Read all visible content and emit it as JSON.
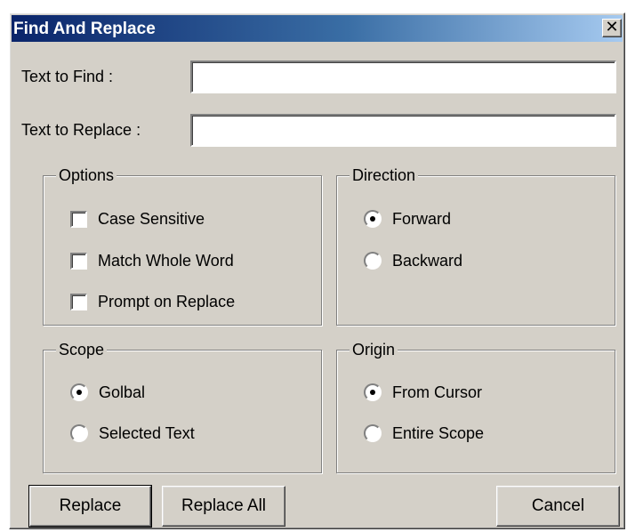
{
  "window": {
    "title": "Find And Replace",
    "close_glyph": "✕"
  },
  "find": {
    "label": "Text to Find :",
    "value": ""
  },
  "replace": {
    "label": "Text to Replace :",
    "value": ""
  },
  "options": {
    "legend": "Options",
    "items": [
      {
        "label": "Case Sensitive",
        "checked": false
      },
      {
        "label": "Match Whole Word",
        "checked": false
      },
      {
        "label": "Prompt on Replace",
        "checked": false
      }
    ]
  },
  "direction": {
    "legend": "Direction",
    "items": [
      {
        "label": "Forward",
        "selected": true
      },
      {
        "label": "Backward",
        "selected": false
      }
    ]
  },
  "scope": {
    "legend": "Scope",
    "items": [
      {
        "label": "Golbal",
        "selected": true
      },
      {
        "label": "Selected Text",
        "selected": false
      }
    ]
  },
  "origin": {
    "legend": "Origin",
    "items": [
      {
        "label": "From Cursor",
        "selected": true
      },
      {
        "label": "Entire Scope",
        "selected": false
      }
    ]
  },
  "buttons": {
    "replace": "Replace",
    "replace_all": "Replace All",
    "cancel": "Cancel"
  },
  "colors": {
    "face": "#d4d0c8",
    "title_start": "#0a246a",
    "title_end": "#a6caf0"
  }
}
